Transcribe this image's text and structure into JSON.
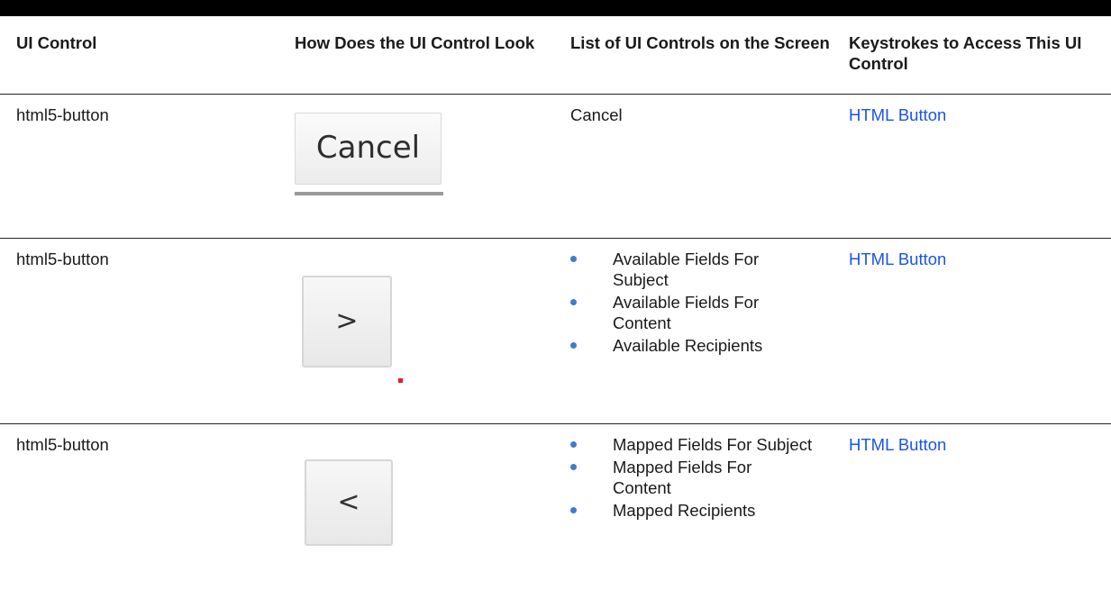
{
  "headers": [
    "UI Control",
    "How Does the UI Control Look",
    "List of UI Controls on the Screen",
    "Keystrokes to Access This UI Control"
  ],
  "rows": [
    {
      "control": "html5-button",
      "look_label": "Cancel",
      "list_text": "Cancel",
      "keystrokes": "HTML Button"
    },
    {
      "control": "html5-button",
      "look_label": ">",
      "list": [
        "Available Fields For Subject",
        "Available Fields For Content",
        "Available Recipients"
      ],
      "keystrokes": "HTML Button"
    },
    {
      "control": "html5-button",
      "look_label": "<",
      "list": [
        "Mapped Fields For Subject",
        "Mapped Fields For Content",
        "Mapped Recipients"
      ],
      "keystrokes": "HTML Button"
    }
  ],
  "colors": {
    "link": "#1a55e6",
    "bullet": "#3e7dcc",
    "rule": "#000000"
  }
}
